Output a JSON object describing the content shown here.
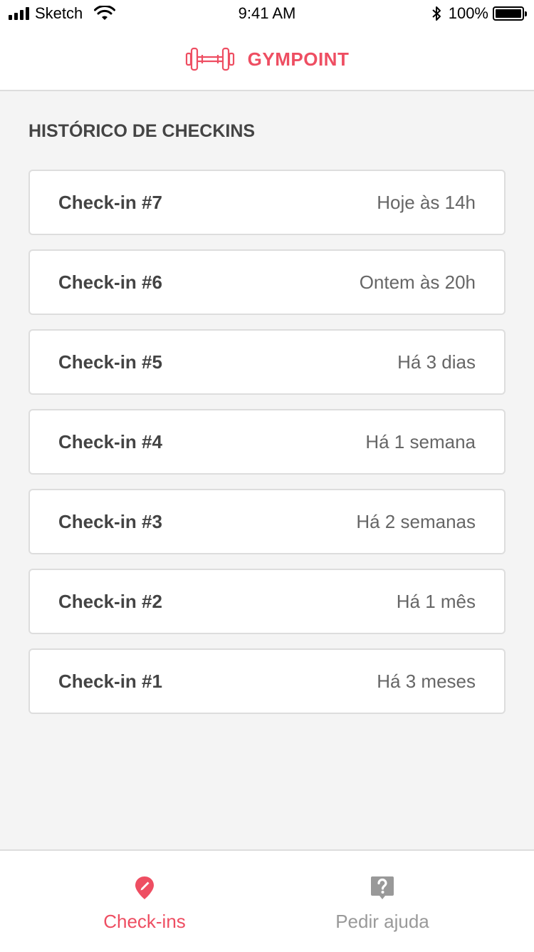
{
  "status_bar": {
    "carrier": "Sketch",
    "time": "9:41 AM",
    "battery": "100%"
  },
  "header": {
    "logo_icon": "dumbbell-icon",
    "brand": "GYMPOINT",
    "brand_color": "#ee4e62"
  },
  "main": {
    "section_title": "HISTÓRICO DE CHECKINS",
    "checkins": [
      {
        "title": "Check-in #7",
        "time": "Hoje às 14h"
      },
      {
        "title": "Check-in #6",
        "time": "Ontem às 20h"
      },
      {
        "title": "Check-in #5",
        "time": "Há 3 dias"
      },
      {
        "title": "Check-in #4",
        "time": "Há 1 semana"
      },
      {
        "title": "Check-in #3",
        "time": "Há 2 semanas"
      },
      {
        "title": "Check-in #2",
        "time": "Há 1 mês"
      },
      {
        "title": "Check-in #1",
        "time": "Há 3 meses"
      }
    ]
  },
  "tabbar": {
    "tabs": [
      {
        "label": "Check-ins",
        "icon": "location-pin-icon",
        "active": true
      },
      {
        "label": "Pedir ajuda",
        "icon": "help-bubble-icon",
        "active": false
      }
    ]
  }
}
